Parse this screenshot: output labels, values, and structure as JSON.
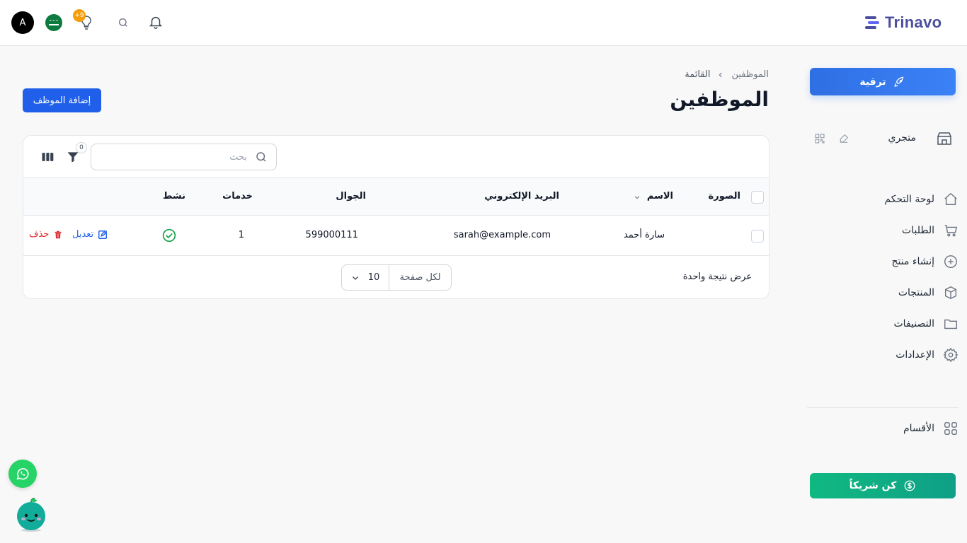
{
  "header": {
    "avatar_initial": "A",
    "bulb_badge": "+9",
    "logo_text": "Trinavo",
    "brand_color": "#4b4f9e"
  },
  "sidebar": {
    "upgrade_label": "ترقية",
    "store_label": "متجري",
    "items": [
      {
        "label": "لوحة التحكم",
        "icon": "home-icon"
      },
      {
        "label": "الطلبات",
        "icon": "cart-icon"
      },
      {
        "label": "إنشاء منتج",
        "icon": "plus-circle-icon"
      },
      {
        "label": "المنتجات",
        "icon": "box-icon"
      },
      {
        "label": "التصنيفات",
        "icon": "folder-icon"
      },
      {
        "label": "الإعدادات",
        "icon": "gear-icon"
      }
    ],
    "sections_label": "الأقسام",
    "partner_label": "كن شريكاً"
  },
  "main": {
    "breadcrumb": [
      "الموظفين",
      "القائمة"
    ],
    "title": "الموظفين",
    "add_button": "إضافة الموظف"
  },
  "table": {
    "search_placeholder": "بحث",
    "filter_count": "0",
    "columns": {
      "image": "الصورة",
      "name": "الاسم",
      "email": "البريد الإلكتروني",
      "mobile": "الجوال",
      "services": "خدمات",
      "active": "نشط"
    },
    "rows": [
      {
        "name": "سارة أحمد",
        "email": "sarah@example.com",
        "mobile": "599000111",
        "services": "1",
        "active": true,
        "edit_label": "تعديل",
        "delete_label": "حذف"
      }
    ],
    "results_text": "عرض نتيجة واحدة",
    "per_page_label": "لكل صفحة",
    "per_page_value": "10"
  },
  "colors": {
    "primary": "#1f5fea",
    "success": "#10b981",
    "danger": "#dc2626"
  }
}
